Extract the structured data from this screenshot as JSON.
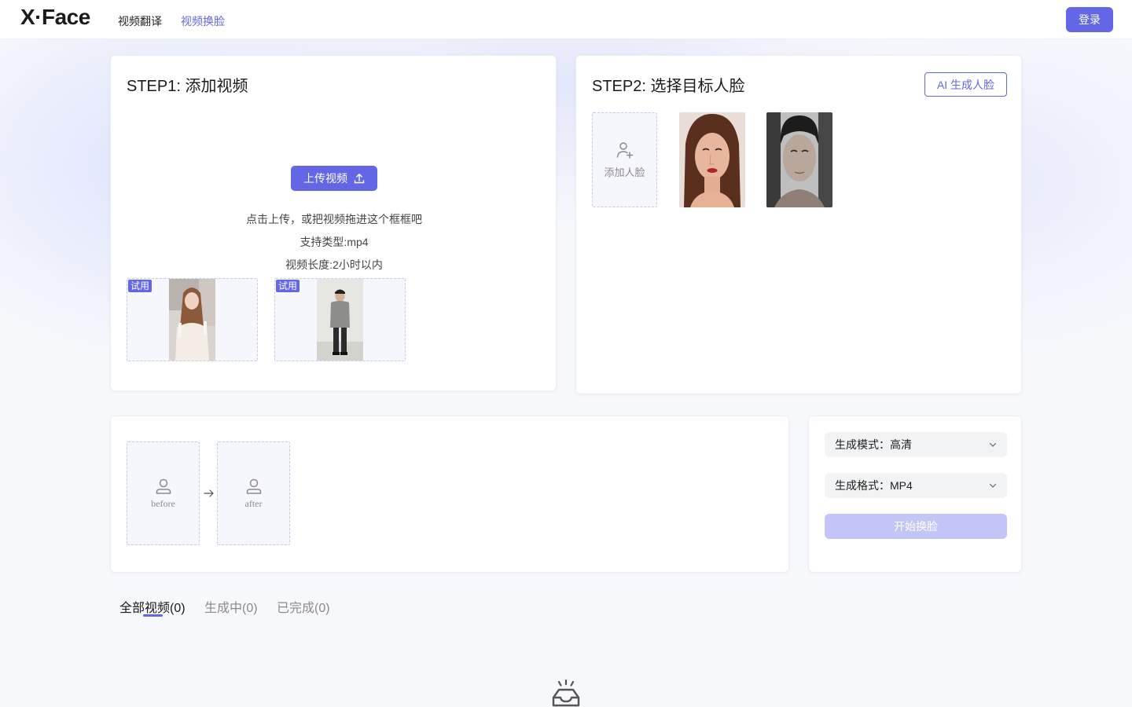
{
  "header": {
    "logo": "X·Face",
    "nav": [
      {
        "label": "视频翻译",
        "active": false
      },
      {
        "label": "视频换脸",
        "active": true
      }
    ],
    "login_label": "登录"
  },
  "step1": {
    "title": "STEP1: 添加视频",
    "upload_label": "上传视频",
    "hint_lines": [
      "点击上传，或把视频拖进这个框框吧",
      "支持类型:mp4",
      "视频长度:2小时以内"
    ],
    "samples": [
      {
        "tag": "试用",
        "icon": "video-thumbnail-woman"
      },
      {
        "tag": "试用",
        "icon": "video-thumbnail-man"
      }
    ]
  },
  "step2": {
    "title": "STEP2: 选择目标人脸",
    "ai_button_label": "AI 生成人脸",
    "add_face_label": "添加人脸",
    "faces": [
      {
        "icon": "face-woman"
      },
      {
        "icon": "face-man"
      }
    ]
  },
  "preview": {
    "before_label": "before",
    "after_label": "after"
  },
  "settings": {
    "mode_label": "生成模式：高清",
    "format_label": "生成格式：MP4",
    "start_label": "开始换脸"
  },
  "tabs": [
    {
      "label": "全部视频(0)",
      "active": true
    },
    {
      "label": "生成中(0)",
      "active": false
    },
    {
      "label": "已完成(0)",
      "active": false
    }
  ],
  "colors": {
    "accent": "#6366e5",
    "accent_disabled": "#c3c5f6",
    "dashed_border": "#c9cbe6"
  }
}
